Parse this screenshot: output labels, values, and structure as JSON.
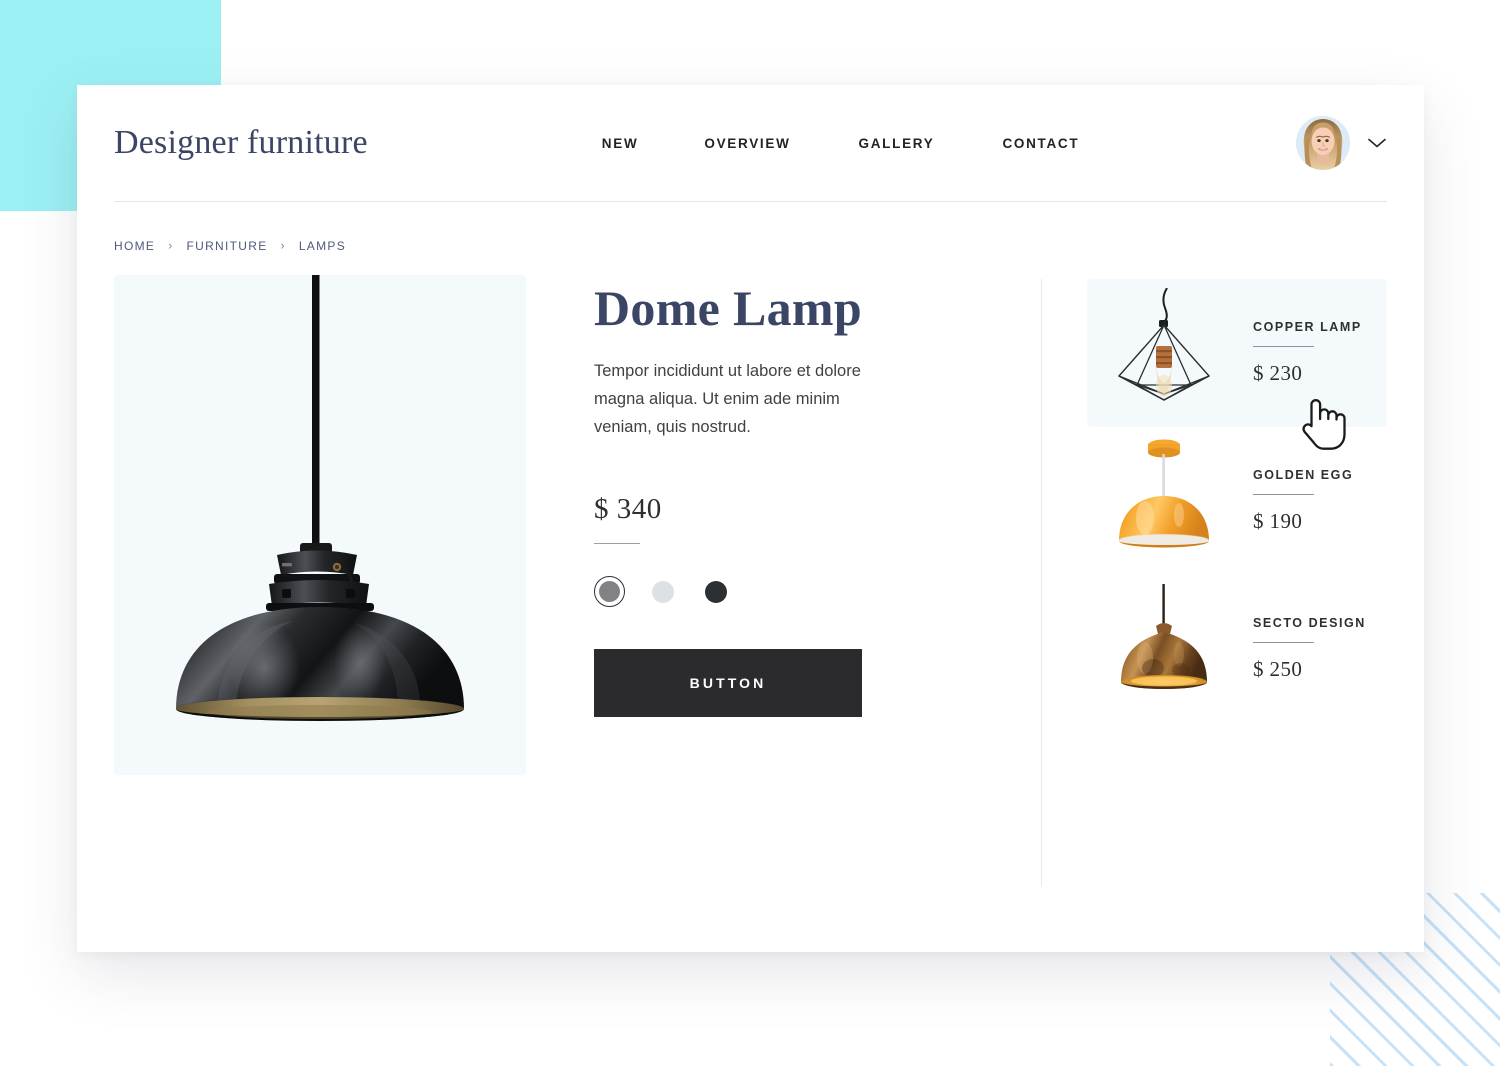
{
  "brand": {
    "name": "Designer furniture"
  },
  "nav": {
    "items": [
      {
        "label": "NEW",
        "name": "nav-item-new"
      },
      {
        "label": "OVERVIEW",
        "name": "nav-item-overview"
      },
      {
        "label": "GALLERY",
        "name": "nav-item-gallery"
      },
      {
        "label": "CONTACT",
        "name": "nav-item-contact"
      }
    ],
    "avatar_alt": "user-avatar",
    "dropdown_icon": "chevron-down-icon"
  },
  "breadcrumb": {
    "separator": "›",
    "items": [
      {
        "label": "HOME"
      },
      {
        "label": "FURNITURE"
      },
      {
        "label": "LAMPS"
      }
    ]
  },
  "product": {
    "image_alt": "black-dome-pendant-lamp",
    "title": "Dome Lamp",
    "description": "Tempor incididunt ut labore et dolore magna aliqua. Ut enim ade minim veniam, quis nostrud.",
    "price": "$ 340",
    "swatches": [
      {
        "name": "swatch-gray",
        "color": "#808285",
        "selected": true
      },
      {
        "name": "swatch-light",
        "color": "#dde1e6",
        "selected": false
      },
      {
        "name": "swatch-charcoal",
        "color": "#2b3035",
        "selected": false
      }
    ],
    "cta_label": "BUTTON"
  },
  "related": {
    "items": [
      {
        "name": "COPPER LAMP",
        "price": "$ 230",
        "image_alt": "wireframe-diamond-cage-pendant-lamp",
        "active": true
      },
      {
        "name": "GOLDEN EGG",
        "price": "$ 190",
        "image_alt": "orange-dome-pendant-lamp",
        "active": false
      },
      {
        "name": "SECTO DESIGN",
        "price": "$ 250",
        "image_alt": "bronze-copper-pendant-lamp",
        "active": false
      }
    ]
  },
  "theme": {
    "accent_cyan": "#9cf0f3",
    "accent_stripe_blue": "#c5e2f9",
    "navy": "#3b4565",
    "dark": "#2b2b2d",
    "panel_tint": "#f4f9fb"
  }
}
